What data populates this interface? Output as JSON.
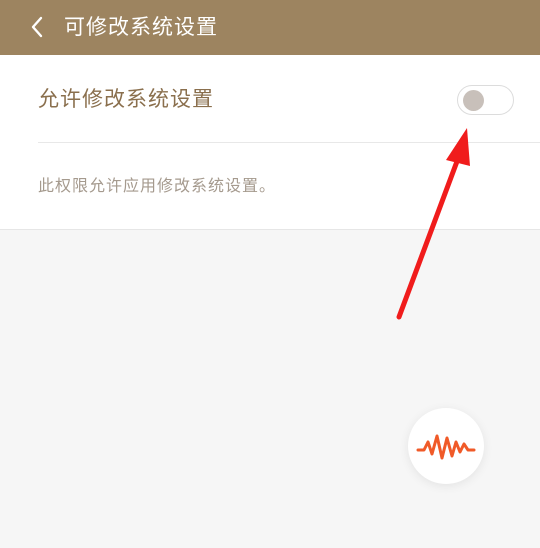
{
  "header": {
    "title": "可修改系统设置",
    "back_icon": "chevron-left-icon"
  },
  "settings": {
    "toggle_label": "允许修改系统设置",
    "toggle_state": "off",
    "description": "此权限允许应用修改系统设置。"
  },
  "floating_button": {
    "icon": "waveform-icon"
  },
  "colors": {
    "header_bg": "#9d8460",
    "label_text": "#8a6f4d",
    "description_text": "#a59a8e",
    "annotation_arrow": "#f01c1c",
    "waveform": "#f05a28"
  }
}
